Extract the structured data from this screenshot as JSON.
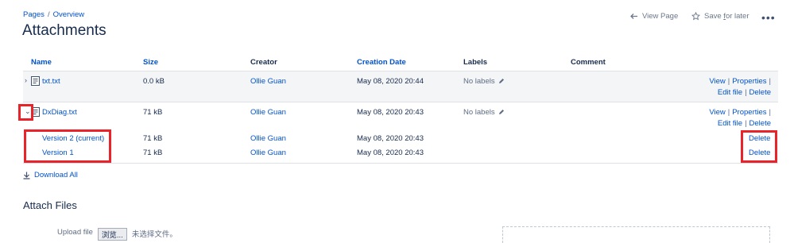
{
  "breadcrumb": {
    "pages": "Pages",
    "separator": "/",
    "overview": "Overview"
  },
  "title": "Attachments",
  "header_actions": {
    "view_page": "View Page",
    "save_prefix": "Save ",
    "save_underlined": "f",
    "save_suffix": "or later",
    "more": "•••"
  },
  "table": {
    "columns": {
      "name": "Name",
      "size": "Size",
      "creator": "Creator",
      "creation_date": "Creation Date",
      "labels": "Labels",
      "comment": "Comment"
    },
    "rows": [
      {
        "name": "txt.txt",
        "size": "0.0 kB",
        "creator": "Ollie Guan",
        "date": "May 08, 2020 20:44",
        "labels": "No labels",
        "actions": {
          "view": "View",
          "properties": "Properties",
          "edit": "Edit file",
          "delete": "Delete"
        }
      },
      {
        "name": "DxDiag.txt",
        "size": "71 kB",
        "creator": "Ollie Guan",
        "date": "May 08, 2020 20:43",
        "labels": "No labels",
        "actions": {
          "view": "View",
          "properties": "Properties",
          "edit": "Edit file",
          "delete": "Delete"
        }
      }
    ],
    "versions": [
      {
        "name": "Version 2 (current)",
        "size": "71 kB",
        "creator": "Ollie Guan",
        "date": "May 08, 2020 20:43",
        "delete": "Delete"
      },
      {
        "name": "Version 1",
        "size": "71 kB",
        "creator": "Ollie Guan",
        "date": "May 08, 2020 20:43",
        "delete": "Delete"
      }
    ],
    "separator": "|"
  },
  "download_all": "Download All",
  "attach_files": {
    "title": "Attach Files",
    "upload_label": "Upload file",
    "browse": "浏览...",
    "no_file": "未选择文件。"
  },
  "colors": {
    "link": "#0052cc",
    "annotation": "#e8242a",
    "row_highlight": "#f4f5f7"
  }
}
